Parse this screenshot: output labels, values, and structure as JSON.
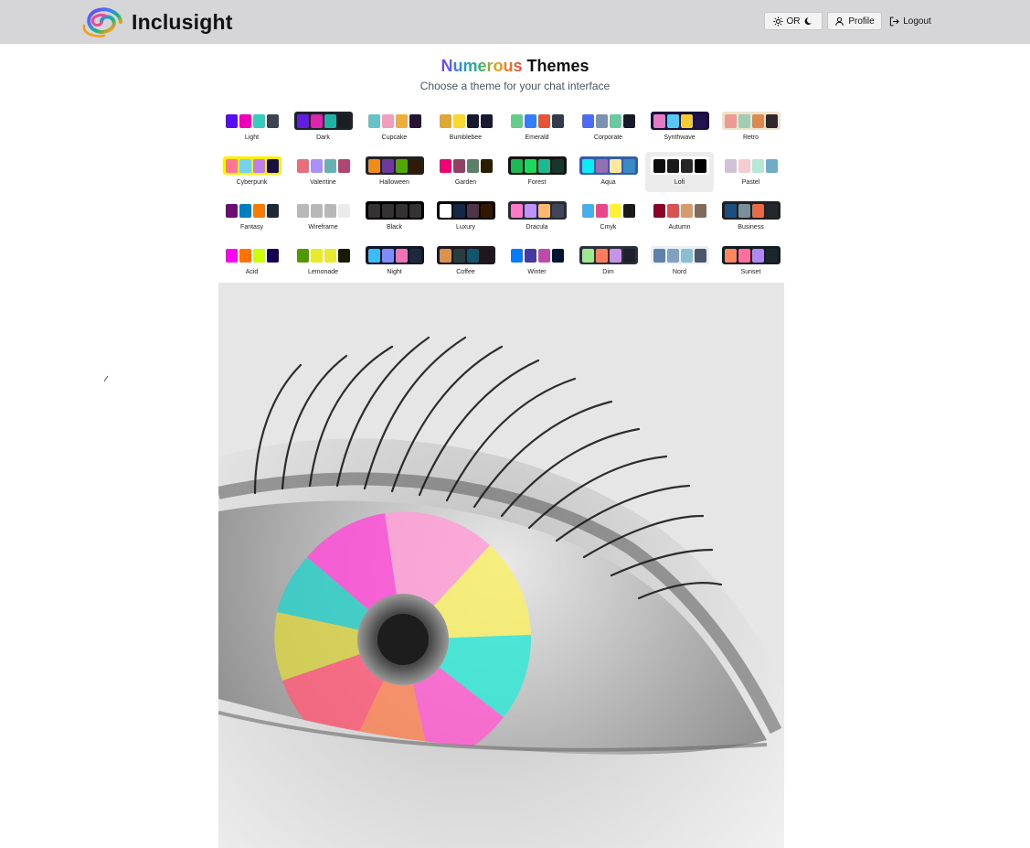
{
  "header": {
    "app_name": "Inclusight",
    "theme_toggle_label": "OR",
    "profile_label": "Profile",
    "logout_label": "Logout"
  },
  "heading": {
    "title_colored": "Numerous",
    "title_rest": " Themes",
    "subtitle": "Choose a theme for your chat interface"
  },
  "themes": [
    {
      "name": "Light",
      "colors": [
        "#570df8",
        "#f000b8",
        "#37cdbe",
        "#3d4451"
      ],
      "active": false
    },
    {
      "name": "Dark",
      "colors": [
        "#661ae6",
        "#d926aa",
        "#1fb2a5",
        "#191e24"
      ],
      "active": false
    },
    {
      "name": "Cupcake",
      "colors": [
        "#65c3c8",
        "#ef9fbc",
        "#eeaf3a",
        "#291334"
      ],
      "active": false
    },
    {
      "name": "Bumblebee",
      "colors": [
        "#e0a82e",
        "#f9d72f",
        "#181830",
        "#181830"
      ],
      "active": false
    },
    {
      "name": "Emerald",
      "colors": [
        "#66cc8a",
        "#377cfb",
        "#ea5234",
        "#333c4d"
      ],
      "active": false
    },
    {
      "name": "Corporate",
      "colors": [
        "#4b6bfb",
        "#7b92b2",
        "#67cba0",
        "#181a2a"
      ],
      "active": false
    },
    {
      "name": "Synthwave",
      "colors": [
        "#e779c1",
        "#58c7f3",
        "#f3cc30",
        "#20134e"
      ],
      "active": false
    },
    {
      "name": "Retro",
      "colors": [
        "#ef9995",
        "#a4cbb4",
        "#dc8850",
        "#2e282a"
      ],
      "active": false
    },
    {
      "name": "Cyberpunk",
      "colors": [
        "#ff7598",
        "#75d1f0",
        "#c07eec",
        "#1a103d"
      ],
      "active": false
    },
    {
      "name": "Valentine",
      "colors": [
        "#e96d7b",
        "#a991f7",
        "#66b1b3",
        "#af4670"
      ],
      "active": false
    },
    {
      "name": "Halloween",
      "colors": [
        "#f28c18",
        "#6d3a9c",
        "#51a800",
        "#2f1b05"
      ],
      "active": false
    },
    {
      "name": "Garden",
      "colors": [
        "#f40076",
        "#8e4162",
        "#5c7f67",
        "#291e00"
      ],
      "active": false
    },
    {
      "name": "Forest",
      "colors": [
        "#1eb854",
        "#1fd65f",
        "#1db990",
        "#19362d"
      ],
      "active": false
    },
    {
      "name": "Aqua",
      "colors": [
        "#09ecf3",
        "#966fb3",
        "#ffe999",
        "#3b8ac4"
      ],
      "active": false
    },
    {
      "name": "Lofi",
      "colors": [
        "#0d0d0d",
        "#1a1919",
        "#262626",
        "#000000"
      ],
      "active": true
    },
    {
      "name": "Pastel",
      "colors": [
        "#d1c1d7",
        "#f6cbd1",
        "#b4e9d6",
        "#70acc7"
      ],
      "active": false
    },
    {
      "name": "Fantasy",
      "colors": [
        "#6e0b75",
        "#007ebd",
        "#f87a00",
        "#1f2937"
      ],
      "active": false
    },
    {
      "name": "Wireframe",
      "colors": [
        "#b8b8b8",
        "#b8b8b8",
        "#b8b8b8",
        "#ebebeb"
      ],
      "active": false
    },
    {
      "name": "Black",
      "colors": [
        "#343232",
        "#343232",
        "#343232",
        "#343232"
      ],
      "active": false
    },
    {
      "name": "Luxury",
      "colors": [
        "#ffffff",
        "#152747",
        "#513448",
        "#331800"
      ],
      "active": false
    },
    {
      "name": "Dracula",
      "colors": [
        "#ff79c6",
        "#bd93f9",
        "#ffb86c",
        "#414558"
      ],
      "active": false
    },
    {
      "name": "Cmyk",
      "colors": [
        "#45aeee",
        "#e8488a",
        "#fff232",
        "#1a1a1a"
      ],
      "active": false
    },
    {
      "name": "Autumn",
      "colors": [
        "#8c0327",
        "#d85251",
        "#d59b6a",
        "#826a5c"
      ],
      "active": false
    },
    {
      "name": "Business",
      "colors": [
        "#1c4e80",
        "#7c909a",
        "#ea6947",
        "#23282e"
      ],
      "active": false
    },
    {
      "name": "Acid",
      "colors": [
        "#ff00f4",
        "#ff7400",
        "#cbfd03",
        "#140152"
      ],
      "active": false
    },
    {
      "name": "Lemonade",
      "colors": [
        "#519903",
        "#e9e92e",
        "#e9e92e",
        "#191a05"
      ],
      "active": false
    },
    {
      "name": "Night",
      "colors": [
        "#38bdf8",
        "#818cf8",
        "#f471b5",
        "#1e293b"
      ],
      "active": false
    },
    {
      "name": "Coffee",
      "colors": [
        "#db924b",
        "#263e3f",
        "#10576d",
        "#20161f"
      ],
      "active": false
    },
    {
      "name": "Winter",
      "colors": [
        "#047aff",
        "#463aa2",
        "#c148ac",
        "#021431"
      ],
      "active": false
    },
    {
      "name": "Dim",
      "colors": [
        "#9fe88d",
        "#ff7d5c",
        "#c792e9",
        "#1c212b"
      ],
      "active": false
    },
    {
      "name": "Nord",
      "colors": [
        "#5e81ac",
        "#81a1c1",
        "#88c0d0",
        "#4c566a"
      ],
      "active": false
    },
    {
      "name": "Sunset",
      "colors": [
        "#ff865b",
        "#fd6f9c",
        "#b387fa",
        "#1b262c"
      ],
      "active": false
    }
  ],
  "theme_swatch_frames": {
    "Dark": "#1d232a",
    "Synthwave": "#1a103d",
    "Retro": "#ece3ca",
    "Cyberpunk": "#ffee00",
    "Halloween": "#212121",
    "Forest": "#171212",
    "Aqua": "#345da7",
    "Black": "#000000",
    "Luxury": "#09090b",
    "Dracula": "#282a36",
    "Business": "#202020",
    "Night": "#0f172a",
    "Coffee": "#211720",
    "Dim": "#2a303c",
    "Nord": "#eceff4",
    "Sunset": "#121c22"
  },
  "icons": {
    "logo": "swirl-logo-icon",
    "sun": "sun-icon",
    "moon": "moon-icon",
    "profile": "user-icon",
    "logout": "logout-icon"
  }
}
